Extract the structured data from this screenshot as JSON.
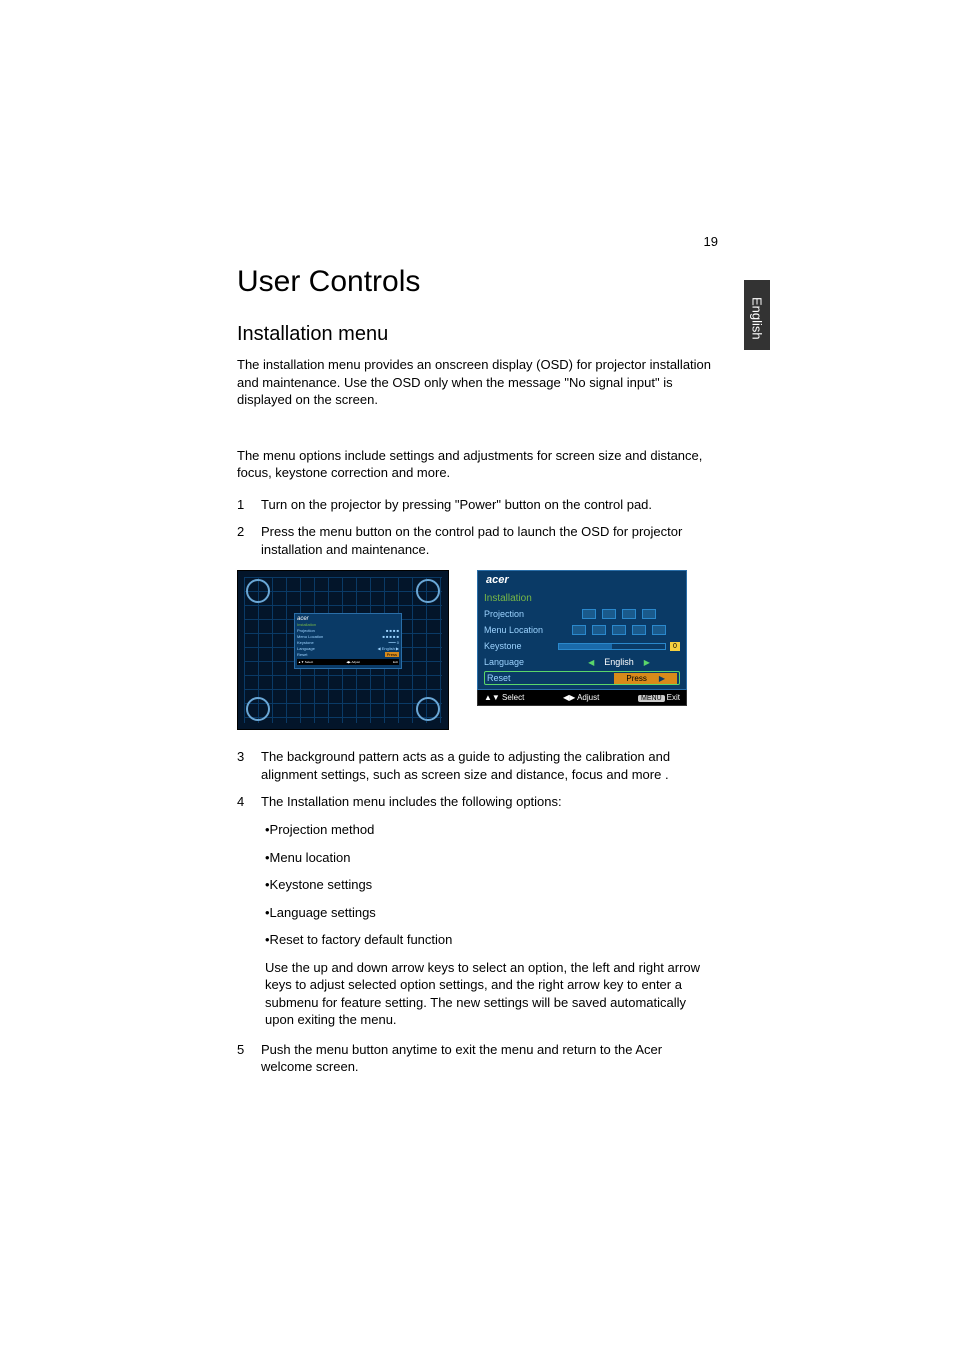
{
  "page_number": "19",
  "side_tab": "English",
  "h1": "User Controls",
  "h2": "Installation menu",
  "para1": "The installation menu provides an onscreen display (OSD) for projector installation and maintenance. Use the OSD only when the message \"No signal input\" is displayed on the screen.",
  "para2": "The menu options include settings and adjustments for screen size and distance, focus, keystone correction and more.",
  "steps": {
    "s1": {
      "n": "1",
      "t": "Turn on the projector by pressing \"Power\" button on the control pad."
    },
    "s2": {
      "n": "2",
      "t": "Press the menu button on the control pad to launch the OSD for projector installation and maintenance."
    },
    "s3": {
      "n": "3",
      "t": "The background pattern acts as a guide to adjusting the calibration and alignment settings, such as screen size and distance, focus and more ."
    },
    "s4": {
      "n": "4",
      "t": "The Installation menu includes the following options:"
    },
    "s5": {
      "n": "5",
      "t": "Push the menu button anytime to exit the menu and return to the Acer welcome screen."
    }
  },
  "bullets": {
    "b1": "•Projection method",
    "b2": "•Menu location",
    "b3": "•Keystone settings",
    "b4": "•Language settings",
    "b5": "•Reset to factory default function"
  },
  "arrow_para": "Use the up and down arrow keys to select an option, the left and right arrow keys to adjust selected option settings, and the right arrow key to enter a submenu for feature setting. The new settings will be saved automatically upon exiting the menu.",
  "osd": {
    "brand": "acer",
    "title": "Installation",
    "rows": {
      "projection": "Projection",
      "menu_location": "Menu Location",
      "keystone": "Keystone",
      "keystone_val": "0",
      "language": "Language",
      "language_val": "English",
      "reset": "Reset",
      "reset_val": "Press"
    },
    "footer": {
      "select": "▲▼ Select",
      "adjust": "◀▶ Adjust",
      "menu_label": "MENU",
      "exit": "Exit"
    }
  },
  "chart_data": {
    "type": "table",
    "title": "Installation OSD menu items",
    "categories": [
      "Projection",
      "Menu Location",
      "Keystone",
      "Language",
      "Reset"
    ],
    "values": [
      "(icons)",
      "(icons)",
      "0",
      "English",
      "Press"
    ]
  }
}
